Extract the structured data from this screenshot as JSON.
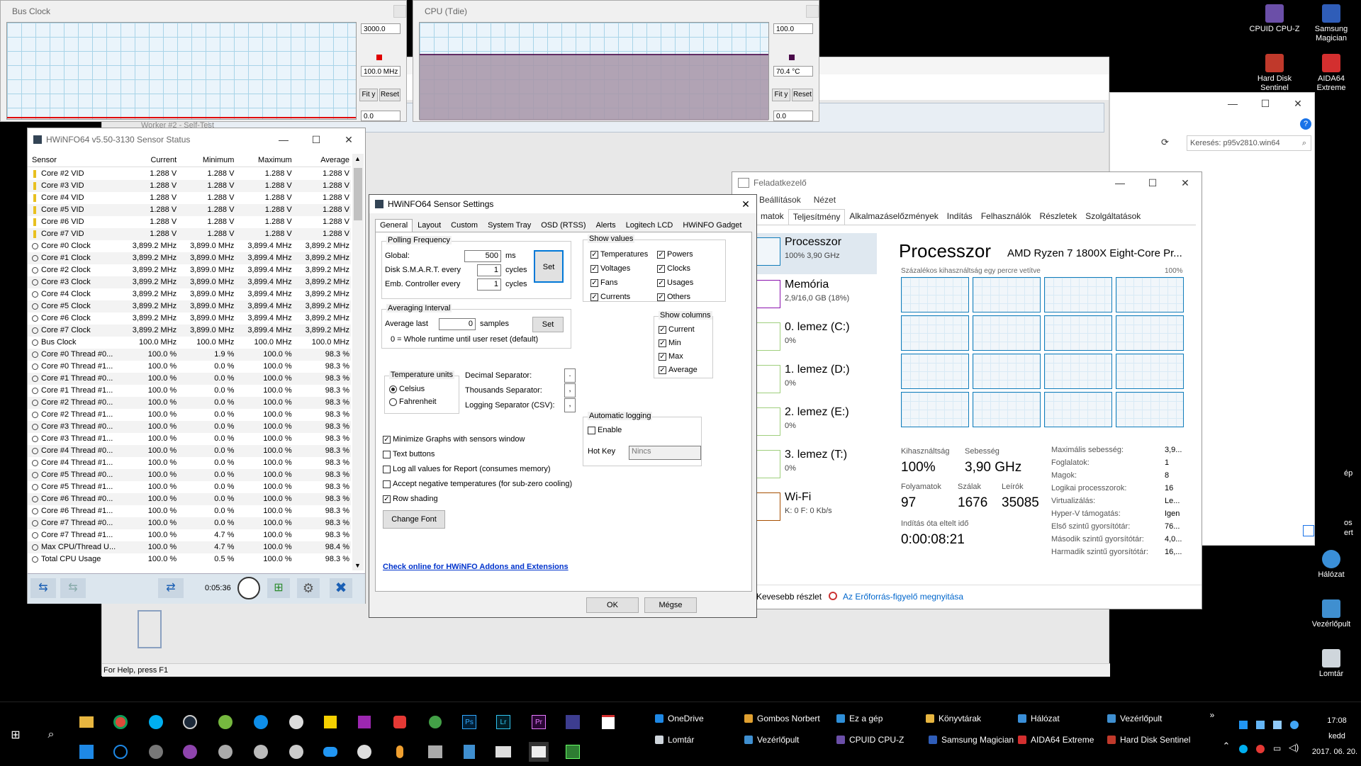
{
  "bus_clock_graph": {
    "title": "Bus Clock",
    "max_value": "3000.0",
    "current_value": "100.0 MHz",
    "min_value": "0.0",
    "fit_label": "Fit y",
    "reset_label": "Reset",
    "color": "#e00000"
  },
  "cpu_graph": {
    "title": "CPU (Tdie)",
    "max_value": "100.0",
    "current_value": "70.4 °C",
    "min_value": "0.0",
    "fit_label": "Fit y",
    "reset_label": "Reset",
    "color": "#4a0a4a"
  },
  "background_window": {
    "title": "Worker #2 - Self-Test",
    "status": "For Help, press F1"
  },
  "explorer": {
    "search_placeholder": "Keresés: p95v2810.win64"
  },
  "hwinfo": {
    "title": "HWiNFO64 v5.50-3130 Sensor Status",
    "columns": [
      "Sensor",
      "Current",
      "Minimum",
      "Maximum",
      "Average"
    ],
    "rows": [
      {
        "icon": "v",
        "name": "Core #2 VID",
        "cur": "1.288 V",
        "min": "1.288 V",
        "max": "1.288 V",
        "avg": "1.288 V"
      },
      {
        "icon": "v",
        "name": "Core #3 VID",
        "cur": "1.288 V",
        "min": "1.288 V",
        "max": "1.288 V",
        "avg": "1.288 V"
      },
      {
        "icon": "v",
        "name": "Core #4 VID",
        "cur": "1.288 V",
        "min": "1.288 V",
        "max": "1.288 V",
        "avg": "1.288 V"
      },
      {
        "icon": "v",
        "name": "Core #5 VID",
        "cur": "1.288 V",
        "min": "1.288 V",
        "max": "1.288 V",
        "avg": "1.288 V"
      },
      {
        "icon": "v",
        "name": "Core #6 VID",
        "cur": "1.288 V",
        "min": "1.288 V",
        "max": "1.288 V",
        "avg": "1.288 V"
      },
      {
        "icon": "v",
        "name": "Core #7 VID",
        "cur": "1.288 V",
        "min": "1.288 V",
        "max": "1.288 V",
        "avg": "1.288 V"
      },
      {
        "icon": "c",
        "name": "Core #0 Clock",
        "cur": "3,899.2 MHz",
        "min": "3,899.0 MHz",
        "max": "3,899.4 MHz",
        "avg": "3,899.2 MHz"
      },
      {
        "icon": "c",
        "name": "Core #1 Clock",
        "cur": "3,899.2 MHz",
        "min": "3,899.0 MHz",
        "max": "3,899.4 MHz",
        "avg": "3,899.2 MHz"
      },
      {
        "icon": "c",
        "name": "Core #2 Clock",
        "cur": "3,899.2 MHz",
        "min": "3,899.0 MHz",
        "max": "3,899.4 MHz",
        "avg": "3,899.2 MHz"
      },
      {
        "icon": "c",
        "name": "Core #3 Clock",
        "cur": "3,899.2 MHz",
        "min": "3,899.0 MHz",
        "max": "3,899.4 MHz",
        "avg": "3,899.2 MHz"
      },
      {
        "icon": "c",
        "name": "Core #4 Clock",
        "cur": "3,899.2 MHz",
        "min": "3,899.0 MHz",
        "max": "3,899.4 MHz",
        "avg": "3,899.2 MHz"
      },
      {
        "icon": "c",
        "name": "Core #5 Clock",
        "cur": "3,899.2 MHz",
        "min": "3,899.0 MHz",
        "max": "3,899.4 MHz",
        "avg": "3,899.2 MHz"
      },
      {
        "icon": "c",
        "name": "Core #6 Clock",
        "cur": "3,899.2 MHz",
        "min": "3,899.0 MHz",
        "max": "3,899.4 MHz",
        "avg": "3,899.2 MHz"
      },
      {
        "icon": "c",
        "name": "Core #7 Clock",
        "cur": "3,899.2 MHz",
        "min": "3,899.0 MHz",
        "max": "3,899.4 MHz",
        "avg": "3,899.2 MHz"
      },
      {
        "icon": "c",
        "name": "Bus Clock",
        "cur": "100.0 MHz",
        "min": "100.0 MHz",
        "max": "100.0 MHz",
        "avg": "100.0 MHz"
      },
      {
        "icon": "c",
        "name": "Core #0 Thread #0...",
        "cur": "100.0 %",
        "min": "1.9 %",
        "max": "100.0 %",
        "avg": "98.3 %"
      },
      {
        "icon": "c",
        "name": "Core #0 Thread #1...",
        "cur": "100.0 %",
        "min": "0.0 %",
        "max": "100.0 %",
        "avg": "98.3 %"
      },
      {
        "icon": "c",
        "name": "Core #1 Thread #0...",
        "cur": "100.0 %",
        "min": "0.0 %",
        "max": "100.0 %",
        "avg": "98.3 %"
      },
      {
        "icon": "c",
        "name": "Core #1 Thread #1...",
        "cur": "100.0 %",
        "min": "0.0 %",
        "max": "100.0 %",
        "avg": "98.3 %"
      },
      {
        "icon": "c",
        "name": "Core #2 Thread #0...",
        "cur": "100.0 %",
        "min": "0.0 %",
        "max": "100.0 %",
        "avg": "98.3 %"
      },
      {
        "icon": "c",
        "name": "Core #2 Thread #1...",
        "cur": "100.0 %",
        "min": "0.0 %",
        "max": "100.0 %",
        "avg": "98.3 %"
      },
      {
        "icon": "c",
        "name": "Core #3 Thread #0...",
        "cur": "100.0 %",
        "min": "0.0 %",
        "max": "100.0 %",
        "avg": "98.3 %"
      },
      {
        "icon": "c",
        "name": "Core #3 Thread #1...",
        "cur": "100.0 %",
        "min": "0.0 %",
        "max": "100.0 %",
        "avg": "98.3 %"
      },
      {
        "icon": "c",
        "name": "Core #4 Thread #0...",
        "cur": "100.0 %",
        "min": "0.0 %",
        "max": "100.0 %",
        "avg": "98.3 %"
      },
      {
        "icon": "c",
        "name": "Core #4 Thread #1...",
        "cur": "100.0 %",
        "min": "0.0 %",
        "max": "100.0 %",
        "avg": "98.3 %"
      },
      {
        "icon": "c",
        "name": "Core #5 Thread #0...",
        "cur": "100.0 %",
        "min": "0.0 %",
        "max": "100.0 %",
        "avg": "98.3 %"
      },
      {
        "icon": "c",
        "name": "Core #5 Thread #1...",
        "cur": "100.0 %",
        "min": "0.0 %",
        "max": "100.0 %",
        "avg": "98.3 %"
      },
      {
        "icon": "c",
        "name": "Core #6 Thread #0...",
        "cur": "100.0 %",
        "min": "0.0 %",
        "max": "100.0 %",
        "avg": "98.3 %"
      },
      {
        "icon": "c",
        "name": "Core #6 Thread #1...",
        "cur": "100.0 %",
        "min": "0.0 %",
        "max": "100.0 %",
        "avg": "98.3 %"
      },
      {
        "icon": "c",
        "name": "Core #7 Thread #0...",
        "cur": "100.0 %",
        "min": "0.0 %",
        "max": "100.0 %",
        "avg": "98.3 %"
      },
      {
        "icon": "c",
        "name": "Core #7 Thread #1...",
        "cur": "100.0 %",
        "min": "4.7 %",
        "max": "100.0 %",
        "avg": "98.3 %"
      },
      {
        "icon": "c",
        "name": "Max CPU/Thread U...",
        "cur": "100.0 %",
        "min": "4.7 %",
        "max": "100.0 %",
        "avg": "98.4 %"
      },
      {
        "icon": "c",
        "name": "Total CPU Usage",
        "cur": "100.0 %",
        "min": "0.5 %",
        "max": "100.0 %",
        "avg": "98.3 %"
      }
    ],
    "elapsed": "0:05:36"
  },
  "settings": {
    "title": "HWiNFO64 Sensor Settings",
    "tabs": [
      "General",
      "Layout",
      "Custom",
      "System Tray",
      "OSD (RTSS)",
      "Alerts",
      "Logitech LCD",
      "HWiNFO Gadget"
    ],
    "polling": {
      "title": "Polling Frequency",
      "global_label": "Global:",
      "global_value": "500",
      "global_unit": "ms",
      "smart_label": "Disk S.M.A.R.T. every",
      "smart_value": "1",
      "smart_unit": "cycles",
      "emb_label": "Emb. Controller every",
      "emb_value": "1",
      "emb_unit": "cycles",
      "set_label": "Set"
    },
    "averaging": {
      "title": "Averaging Interval",
      "label": "Average last",
      "value": "0",
      "unit": "samples",
      "set_label": "Set",
      "note": "0 = Whole runtime until user reset (default)"
    },
    "show_values": {
      "title": "Show values",
      "items": [
        "Temperatures",
        "Powers",
        "Voltages",
        "Clocks",
        "Fans",
        "Usages",
        "Currents",
        "Others"
      ]
    },
    "show_columns": {
      "title": "Show columns",
      "items": [
        "Current",
        "Min",
        "Max",
        "Average"
      ]
    },
    "temp_units": {
      "title": "Temperature units",
      "celsius": "Celsius",
      "fahrenheit": "Fahrenheit"
    },
    "separators": {
      "decimal_label": "Decimal Separator:",
      "decimal_value": ".",
      "thousands_label": "Thousands Separator:",
      "thousands_value": ",",
      "logging_label": "Logging Separator (CSV):",
      "logging_value": ","
    },
    "auto_logging": {
      "title": "Automatic logging",
      "enable_label": "Enable",
      "hotkey_label": "Hot Key",
      "hotkey_value": "Nincs"
    },
    "options": [
      {
        "label": "Minimize Graphs with sensors window",
        "checked": true
      },
      {
        "label": "Text buttons",
        "checked": false
      },
      {
        "label": "Log all values for Report (consumes memory)",
        "checked": false
      },
      {
        "label": "Accept negative temperatures (for sub-zero cooling)",
        "checked": false
      },
      {
        "label": "Row shading",
        "checked": true
      }
    ],
    "change_font": "Change Font",
    "link": "Check online for HWiNFO Addons and Extensions",
    "ok": "OK",
    "cancel": "Mégse"
  },
  "taskmgr": {
    "title": "Feladatkezelő",
    "menu": [
      "Beállítások",
      "Nézet"
    ],
    "tabs": [
      "matok",
      "Teljesítmény",
      "Alkalmazáselőzmények",
      "Indítás",
      "Felhasználók",
      "Részletek",
      "Szolgáltatások"
    ],
    "side": [
      {
        "name": "Processzor",
        "sub": "100% 3,90 GHz"
      },
      {
        "name": "Memória",
        "sub": "2,9/16,0 GB (18%)"
      },
      {
        "name": "0. lemez (C:)",
        "sub": "0%"
      },
      {
        "name": "1. lemez (D:)",
        "sub": "0%"
      },
      {
        "name": "2. lemez (E:)",
        "sub": "0%"
      },
      {
        "name": "3. lemez (T:)",
        "sub": "0%"
      },
      {
        "name": "Wi-Fi",
        "sub": "K: 0 F: 0 Kb/s"
      }
    ],
    "heading": "Processzor",
    "cpu_name": "AMD Ryzen 7 1800X Eight-Core Pr...",
    "graph_caption": "Százalékos kihasználtság egy percre vetítve",
    "graph_max": "100%",
    "stats": {
      "util_label": "Kihasználtság",
      "util_value": "100%",
      "speed_label": "Sebesség",
      "speed_value": "3,90 GHz",
      "proc_label": "Folyamatok",
      "proc_value": "97",
      "threads_label": "Szálak",
      "threads_value": "1676",
      "handles_label": "Leírók",
      "handles_value": "35085",
      "uptime_label": "Indítás óta eltelt idő",
      "uptime_value": "0:00:08:21"
    },
    "details": [
      {
        "k": "Maximális sebesség:",
        "v": "3,9..."
      },
      {
        "k": "Foglalatok:",
        "v": "1"
      },
      {
        "k": "Magok:",
        "v": "8"
      },
      {
        "k": "Logikai processzorok:",
        "v": "16"
      },
      {
        "k": "Virtualizálás:",
        "v": "Le..."
      },
      {
        "k": "Hyper-V támogatás:",
        "v": "Igen"
      },
      {
        "k": "Első szintű gyorsítótár:",
        "v": "76..."
      },
      {
        "k": "Második szintű gyorsítótár:",
        "v": "4,0..."
      },
      {
        "k": "Harmadik szintű gyorsítótár:",
        "v": "16,..."
      }
    ],
    "fewer_details": "Kevesebb részlet",
    "resource_monitor": "Az Erőforrás-figyelő megnyitása"
  },
  "desktop_icons": [
    {
      "label": "CPUID CPU-Z",
      "color": "#6b4fa8"
    },
    {
      "label": "Samsung Magician",
      "color": "#2f5db8"
    },
    {
      "label": "Hard Disk Sentinel",
      "color": "#c0392b"
    },
    {
      "label": "AIDA64 Extreme",
      "color": "#d32f2f"
    },
    {
      "label": "Hálózat",
      "color": "#3a8fd8"
    },
    {
      "label": "Vezérlőpult",
      "color": "#3f8fd0"
    },
    {
      "label": "Lomtár",
      "color": "#cfd6dc"
    }
  ],
  "desktop_edge_labels": {
    "partial1": "ép",
    "partial2": "os",
    "partial3": "ert"
  },
  "taskbar": {
    "quick_links": [
      {
        "label": "OneDrive",
        "color": "#1e88e5"
      },
      {
        "label": "Gombos Norbert",
        "color": "#e0a030"
      },
      {
        "label": "Ez a gép",
        "color": "#2f8fd8"
      },
      {
        "label": "Könyvtárak",
        "color": "#e8b640"
      },
      {
        "label": "Hálózat",
        "color": "#3a8fd8"
      },
      {
        "label": "Vezérlőpult",
        "color": "#3f8fd0"
      },
      {
        "label": "Lomtár",
        "color": "#cfd6dc"
      },
      {
        "label": "Vezérlőpult",
        "color": "#3f8fd0"
      },
      {
        "label": "CPUID CPU-Z",
        "color": "#6b4fa8"
      },
      {
        "label": "Samsung Magician",
        "color": "#2f5db8"
      },
      {
        "label": "AIDA64 Extreme",
        "color": "#d32f2f"
      },
      {
        "label": "Hard Disk Sentinel",
        "color": "#c0392b"
      }
    ],
    "clock_time": "17:08",
    "clock_day": "kedd",
    "clock_date": "2017. 06. 20."
  }
}
